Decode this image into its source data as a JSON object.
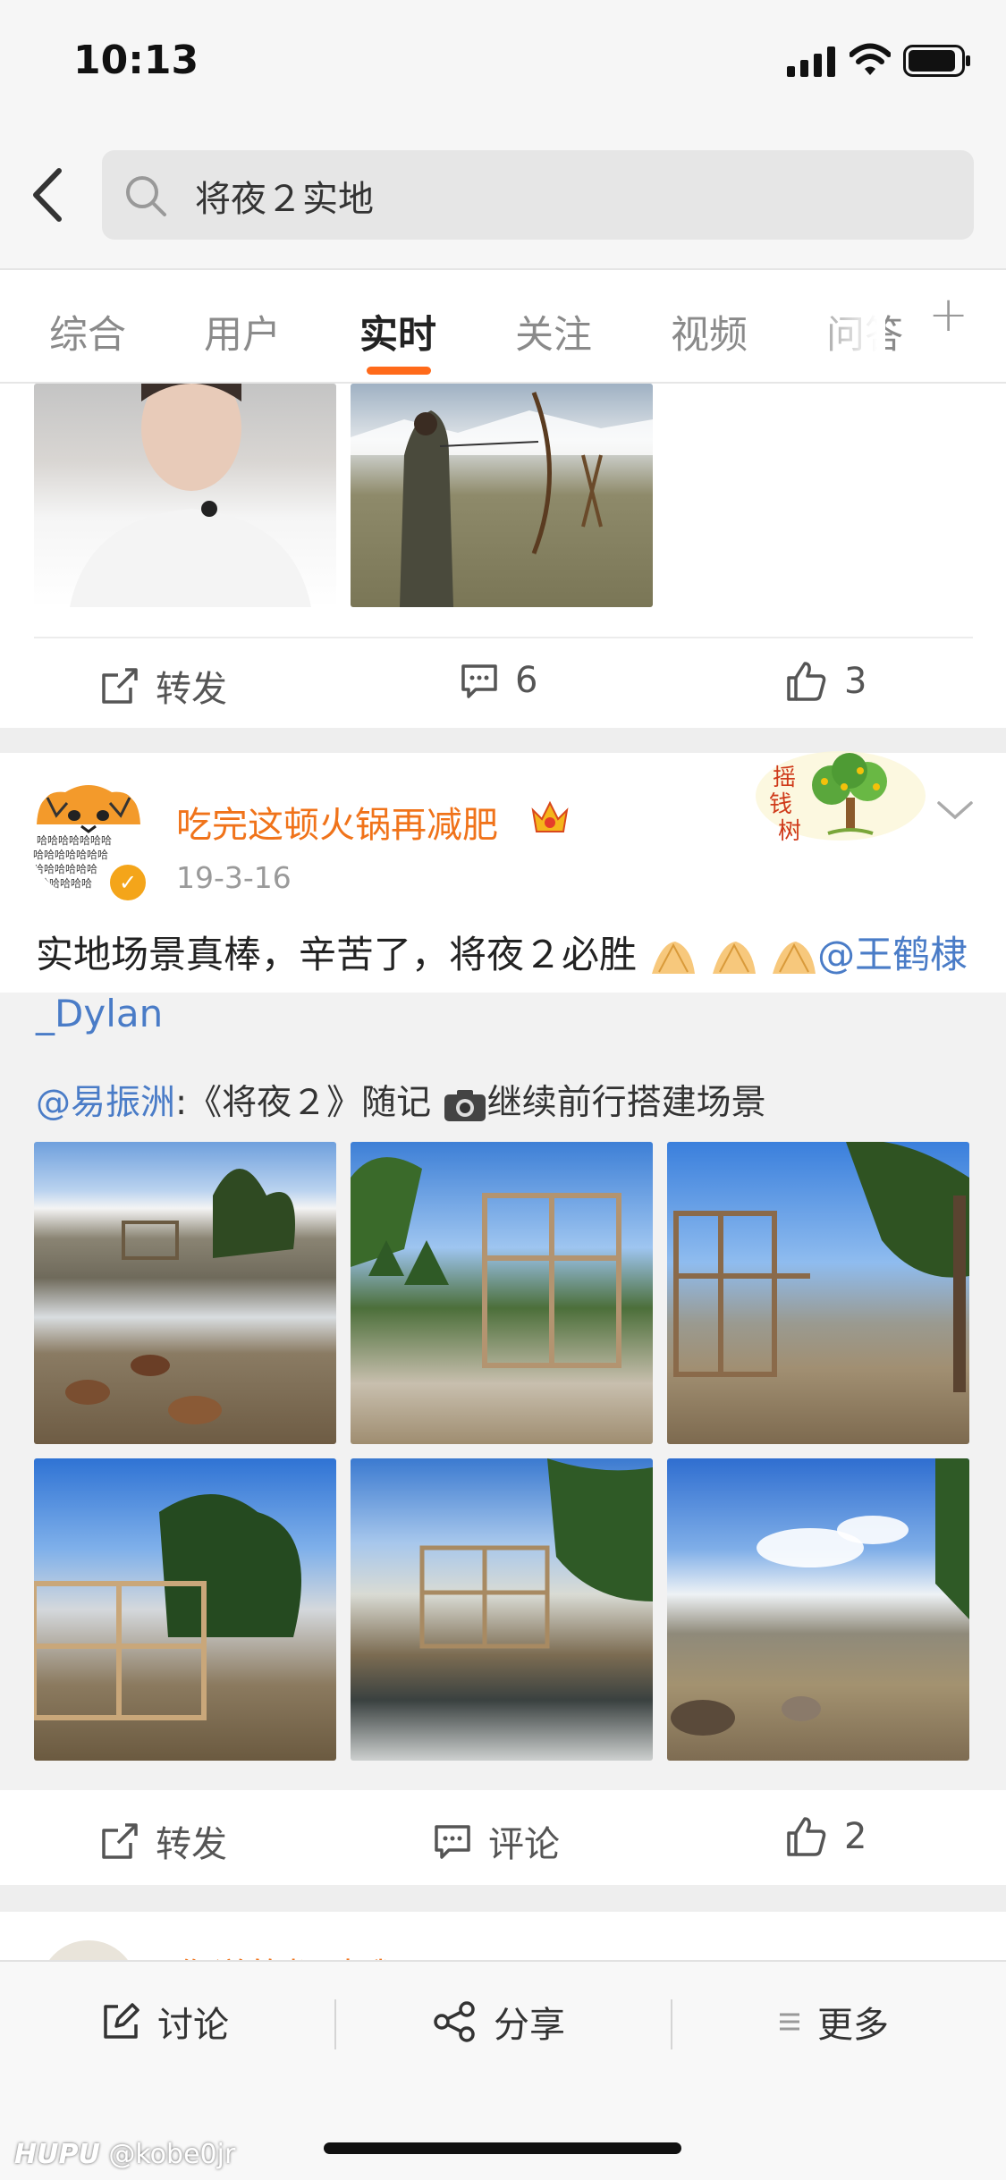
{
  "status_bar": {
    "time": "10:13"
  },
  "header": {
    "search_query": "将夜２实地"
  },
  "tabs": [
    {
      "label": "综合"
    },
    {
      "label": "用户"
    },
    {
      "label": "实时"
    },
    {
      "label": "关注"
    },
    {
      "label": "视频"
    },
    {
      "label": "问答"
    }
  ],
  "active_tab": "实时",
  "post1": {
    "actions": {
      "repost": "转发",
      "comments": "6",
      "likes": "3"
    }
  },
  "post2": {
    "username": "吃完这顿火锅再减肥",
    "date": "19-3-16",
    "text": "实地场景真棒，辛苦了，将夜２必胜",
    "mention": "@王鹤棣_Dylan",
    "badge_text": [
      "摇",
      "钱",
      "树"
    ],
    "retweet": {
      "author": "@易振洲",
      "text": ":《将夜２》随记",
      "text_after": "继续前行搭建场景"
    },
    "actions": {
      "repost": "转发",
      "comment": "评论",
      "likes": "2"
    }
  },
  "post3": {
    "username_partial": "你说的都对哦"
  },
  "bottom_bar": {
    "discuss": "讨论",
    "share": "分享",
    "more": "更多"
  },
  "watermark": {
    "brand": "HUPU",
    "user": "@kobe0jr"
  },
  "colors": {
    "accent": "#ff6a1a",
    "username": "#f0731a",
    "link": "#4a7cc7"
  }
}
